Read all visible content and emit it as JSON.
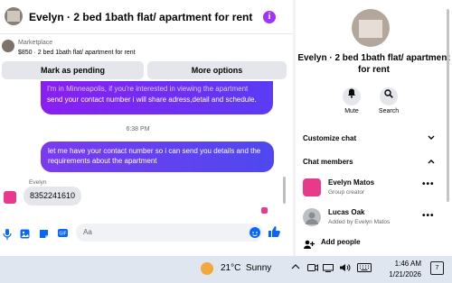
{
  "chat": {
    "title": "Evelyn · 2 bed 1bath flat/ apartment for rent",
    "marketplace_label": "Marketplace",
    "listing": "$850 · 2 bed 1bath flat/ apartment for rent",
    "mark_pending_label": "Mark as pending",
    "more_options_label": "More options",
    "msg1_faded": "I'm in Minneapolis, if you're interested in viewing the apartment",
    "msg1_body": "send your contact number i will share adress,detail and schedule.",
    "timestamp": "6:38 PM",
    "msg2": "let me have your contact number so i can send you details and the requirements about the apartment",
    "sender_name": "Evelyn",
    "reply": "8352241610",
    "composer_placeholder": "Aa"
  },
  "panel": {
    "title": "Evelyn · 2 bed 1bath flat/ apartment for rent",
    "mute_label": "Mute",
    "search_label": "Search",
    "customize_label": "Customize chat",
    "members_label": "Chat members",
    "members": [
      {
        "name": "Evelyn Matos",
        "role": "Group creator",
        "avatar_color": "#e83a8c"
      },
      {
        "name": "Lucas Oak",
        "role": "Added by Evelyn Matos",
        "avatar_color": "#bcc0c4"
      }
    ],
    "add_people_label": "Add people"
  },
  "taskbar": {
    "temperature": "21°C",
    "condition": "Sunny",
    "time": "1:46 AM",
    "date": "1/21/2026",
    "notification_count": "7"
  },
  "colors": {
    "accent": "#0866ff",
    "bubble_start": "#8a1ef2",
    "bubble_end": "#4e48f0"
  }
}
